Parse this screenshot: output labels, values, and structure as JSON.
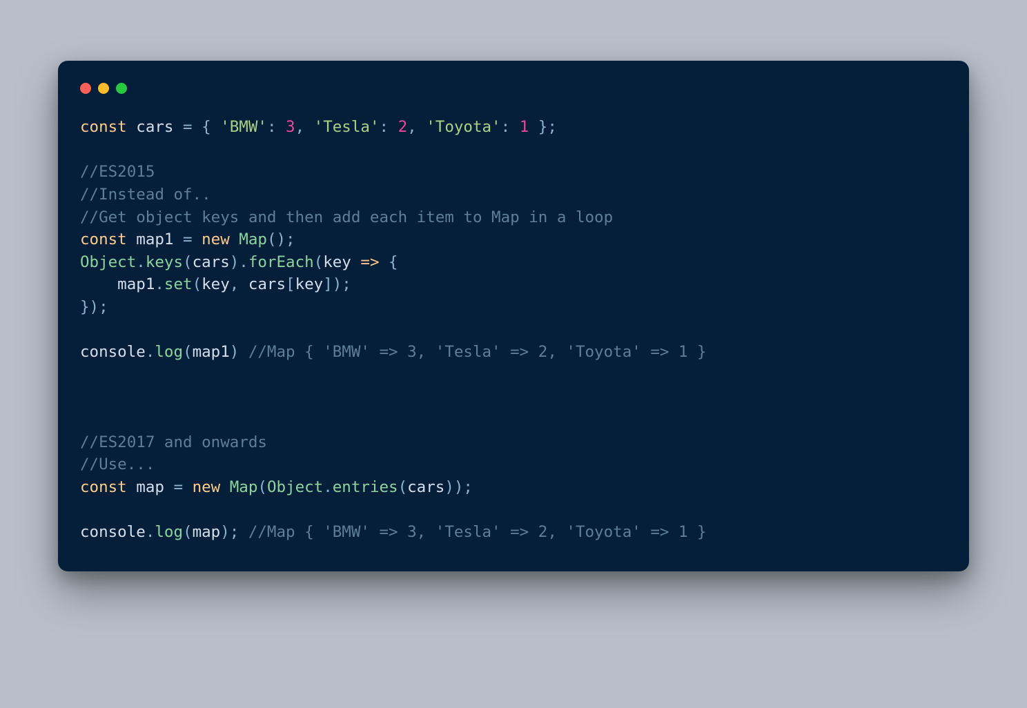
{
  "window": {
    "traffic_lights": [
      "close",
      "minimize",
      "zoom"
    ]
  },
  "code": {
    "lines": [
      [
        {
          "t": "const ",
          "c": "tok-kw"
        },
        {
          "t": "cars ",
          "c": "tok-ident"
        },
        {
          "t": "= ",
          "c": "tok-op"
        },
        {
          "t": "{ ",
          "c": "tok-punct"
        },
        {
          "t": "'BMW'",
          "c": "tok-str"
        },
        {
          "t": ": ",
          "c": "tok-punct"
        },
        {
          "t": "3",
          "c": "tok-num"
        },
        {
          "t": ", ",
          "c": "tok-punct"
        },
        {
          "t": "'Tesla'",
          "c": "tok-str"
        },
        {
          "t": ": ",
          "c": "tok-punct"
        },
        {
          "t": "2",
          "c": "tok-num"
        },
        {
          "t": ", ",
          "c": "tok-punct"
        },
        {
          "t": "'Toyota'",
          "c": "tok-str"
        },
        {
          "t": ": ",
          "c": "tok-punct"
        },
        {
          "t": "1",
          "c": "tok-num"
        },
        {
          "t": " };",
          "c": "tok-punct"
        }
      ],
      [],
      [
        {
          "t": "//ES2015",
          "c": "tok-comment"
        }
      ],
      [
        {
          "t": "//Instead of..",
          "c": "tok-comment"
        }
      ],
      [
        {
          "t": "//Get object keys and then add each item to Map in a loop",
          "c": "tok-comment"
        }
      ],
      [
        {
          "t": "const ",
          "c": "tok-kw"
        },
        {
          "t": "map1 ",
          "c": "tok-ident"
        },
        {
          "t": "= ",
          "c": "tok-op"
        },
        {
          "t": "new ",
          "c": "tok-kw"
        },
        {
          "t": "Map",
          "c": "tok-class"
        },
        {
          "t": "();",
          "c": "tok-punct"
        }
      ],
      [
        {
          "t": "Object",
          "c": "tok-class"
        },
        {
          "t": ".",
          "c": "tok-punct"
        },
        {
          "t": "keys",
          "c": "tok-method"
        },
        {
          "t": "(",
          "c": "tok-punct"
        },
        {
          "t": "cars",
          "c": "tok-ident"
        },
        {
          "t": ")",
          "c": "tok-punct"
        },
        {
          "t": ".",
          "c": "tok-punct"
        },
        {
          "t": "forEach",
          "c": "tok-method"
        },
        {
          "t": "(",
          "c": "tok-punct"
        },
        {
          "t": "key ",
          "c": "tok-ident"
        },
        {
          "t": "=>",
          "c": "tok-arrow"
        },
        {
          "t": " {",
          "c": "tok-punct"
        }
      ],
      [
        {
          "t": "    map1",
          "c": "tok-ident"
        },
        {
          "t": ".",
          "c": "tok-punct"
        },
        {
          "t": "set",
          "c": "tok-method"
        },
        {
          "t": "(",
          "c": "tok-punct"
        },
        {
          "t": "key",
          "c": "tok-ident"
        },
        {
          "t": ", ",
          "c": "tok-punct"
        },
        {
          "t": "cars",
          "c": "tok-ident"
        },
        {
          "t": "[",
          "c": "tok-punct"
        },
        {
          "t": "key",
          "c": "tok-ident"
        },
        {
          "t": "]);",
          "c": "tok-punct"
        }
      ],
      [
        {
          "t": "});",
          "c": "tok-punct"
        }
      ],
      [],
      [
        {
          "t": "console",
          "c": "tok-ident"
        },
        {
          "t": ".",
          "c": "tok-punct"
        },
        {
          "t": "log",
          "c": "tok-method"
        },
        {
          "t": "(",
          "c": "tok-punct"
        },
        {
          "t": "map1",
          "c": "tok-ident"
        },
        {
          "t": ") ",
          "c": "tok-punct"
        },
        {
          "t": "//Map { 'BMW' => 3, 'Tesla' => 2, 'Toyota' => 1 }",
          "c": "tok-comment"
        }
      ],
      [],
      [],
      [],
      [
        {
          "t": "//ES2017 and onwards",
          "c": "tok-comment"
        }
      ],
      [
        {
          "t": "//Use...",
          "c": "tok-comment"
        }
      ],
      [
        {
          "t": "const ",
          "c": "tok-kw"
        },
        {
          "t": "map ",
          "c": "tok-ident"
        },
        {
          "t": "= ",
          "c": "tok-op"
        },
        {
          "t": "new ",
          "c": "tok-kw"
        },
        {
          "t": "Map",
          "c": "tok-class"
        },
        {
          "t": "(",
          "c": "tok-punct"
        },
        {
          "t": "Object",
          "c": "tok-class"
        },
        {
          "t": ".",
          "c": "tok-punct"
        },
        {
          "t": "entries",
          "c": "tok-method"
        },
        {
          "t": "(",
          "c": "tok-punct"
        },
        {
          "t": "cars",
          "c": "tok-ident"
        },
        {
          "t": "));",
          "c": "tok-punct"
        }
      ],
      [],
      [
        {
          "t": "console",
          "c": "tok-ident"
        },
        {
          "t": ".",
          "c": "tok-punct"
        },
        {
          "t": "log",
          "c": "tok-method"
        },
        {
          "t": "(",
          "c": "tok-punct"
        },
        {
          "t": "map",
          "c": "tok-ident"
        },
        {
          "t": "); ",
          "c": "tok-punct"
        },
        {
          "t": "//Map { 'BMW' => 3, 'Tesla' => 2, 'Toyota' => 1 }",
          "c": "tok-comment"
        }
      ]
    ]
  }
}
